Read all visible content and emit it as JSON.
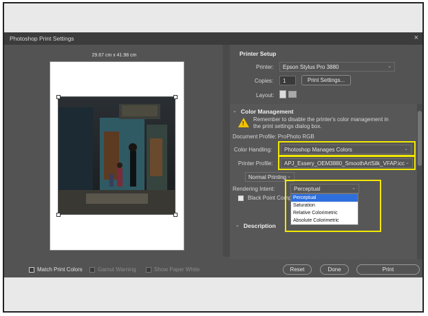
{
  "dialog": {
    "title": "Photoshop Print Settings",
    "close_symbol": "×",
    "paper_size": "29.67 cm x 41.98 cm"
  },
  "printer_setup": {
    "title": "Printer Setup",
    "printer_label": "Printer:",
    "printer_value": "Epson Stylus Pro 3880",
    "copies_label": "Copies:",
    "copies_value": "1",
    "print_settings_button": "Print Settings...",
    "layout_label": "Layout:"
  },
  "color_management": {
    "title": "Color Management",
    "warning_text": "Remember to disable the printer's color management in the print settings dialog box.",
    "document_profile": "Document Profile: ProPhoto RGB",
    "color_handling_label": "Color Handling:",
    "color_handling_value": "Photoshop Manages Colors",
    "printer_profile_label": "Printer Profile:",
    "printer_profile_value": "APJ_Essery_OEM3880_SmoothArtSilk_VFAP.icc",
    "normal_printing": "Normal Printing",
    "rendering_intent_label": "Rendering Intent:",
    "rendering_intent_value": "Perceptual",
    "rendering_options": [
      "Perceptual",
      "Saturation",
      "Relative Colorimetric",
      "Absolute Colorimetric"
    ],
    "black_point_label": "Black Point Comp"
  },
  "description": {
    "title": "Description"
  },
  "footer": {
    "match_print_colors": "Match Print Colors",
    "gamut_warning": "Gamut Warning",
    "show_paper_white": "Show Paper White",
    "reset": "Reset",
    "done": "Done",
    "print": "Print"
  },
  "colors": {
    "highlight": "#f2e800",
    "dialog_bg": "#535353",
    "menu_selected": "#2f6fdc"
  }
}
